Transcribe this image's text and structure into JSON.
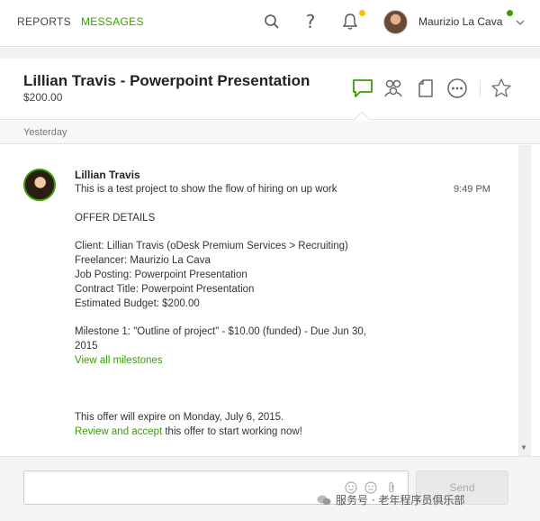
{
  "nav": {
    "reports": "REPORTS",
    "messages": "MESSAGES",
    "help": "?",
    "user_name": "Maurizio La Cava",
    "icons": [
      "search-icon",
      "help-icon",
      "bell-icon",
      "avatar",
      "chevron-down-icon"
    ]
  },
  "header": {
    "title": "Lillian Travis - Powerpoint Presentation",
    "budget": "$200.00",
    "icons": [
      "chat-icon",
      "people-icon",
      "document-icon",
      "more-icon",
      "star-icon"
    ],
    "active_icon": "chat-icon"
  },
  "date_divider": "Yesterday",
  "message": {
    "sender": "Lillian Travis",
    "time": "9:49 PM",
    "lines": {
      "intro": "This is a test project to show the flow of hiring on up work",
      "offer_heading": "OFFER DETAILS",
      "client": "Client: Lillian Travis (oDesk Premium Services > Recruiting)",
      "freelancer": "Freelancer: Maurizio La Cava",
      "posting": "Job Posting: Powerpoint Presentation",
      "contract": "Contract Title: Powerpoint Presentation",
      "budget": "Estimated Budget: $200.00",
      "milestone_1": "Milestone 1: \"Outline of project\" - $10.00 (funded) - Due Jun 30,",
      "milestone_2": "2015",
      "view_milestones": "View all milestones",
      "expire": "This offer will expire on Monday, July 6, 2015.",
      "review_link": "Review and accept",
      "review_rest": " this offer to start working now!"
    }
  },
  "composer": {
    "send_label": "Send",
    "icons": [
      "emoji-icon",
      "emoji-icon",
      "attachment-icon"
    ]
  },
  "watermark": "服务号 · 老年程序员俱乐部",
  "colors": {
    "accent": "#37a000",
    "notification": "#f5c400",
    "divider": "#e3e3e3"
  }
}
